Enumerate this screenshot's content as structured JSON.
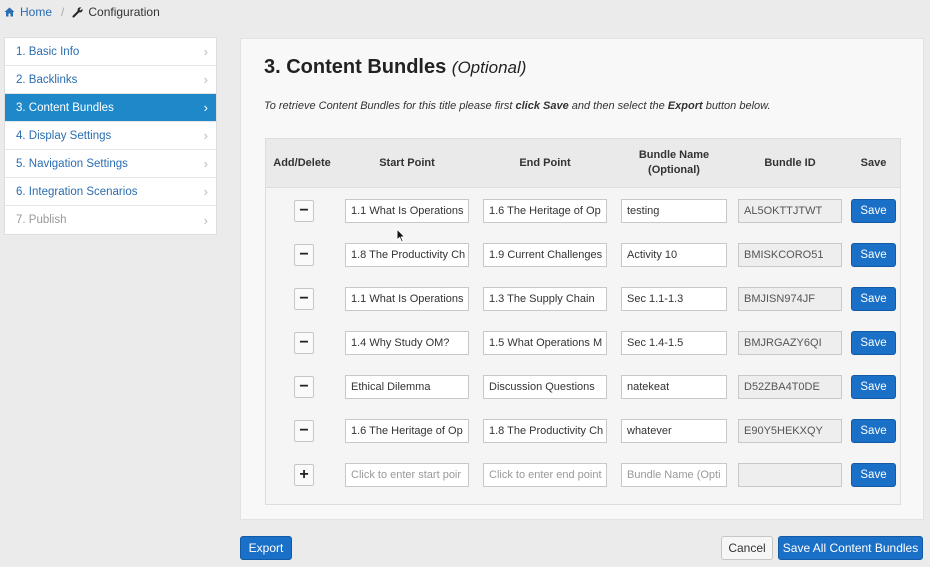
{
  "breadcrumb": {
    "home": "Home",
    "current": "Configuration"
  },
  "sidebar": {
    "items": [
      {
        "label": "1. Basic Info"
      },
      {
        "label": "2. Backlinks"
      },
      {
        "label": "3. Content Bundles"
      },
      {
        "label": "4. Display Settings"
      },
      {
        "label": "5. Navigation Settings"
      },
      {
        "label": "6. Integration Scenarios"
      },
      {
        "label": "7. Publish"
      }
    ]
  },
  "main": {
    "title": "3. Content Bundles",
    "title_optional": "(Optional)",
    "instruction": {
      "part1": "To retrieve Content Bundles for this title please first ",
      "bold1": "click Save",
      "part2": " and then select the ",
      "bold2": "Export",
      "part3": " button below."
    }
  },
  "table": {
    "headers": {
      "add_delete": "Add/Delete",
      "start": "Start Point",
      "end": "End Point",
      "name_line1": "Bundle Name",
      "name_line2": "(Optional)",
      "id": "Bundle ID",
      "save": "Save"
    },
    "rows": [
      {
        "action": "−",
        "start": "1.1 What Is Operations",
        "end": "1.6 The Heritage of Op",
        "name": "testing",
        "id": "AL5OKTTJTWT",
        "save": "Save"
      },
      {
        "action": "−",
        "start": "1.8 The Productivity Ch",
        "end": "1.9 Current Challenges",
        "name": "Activity 10",
        "id": "BMISKCORO51",
        "save": "Save"
      },
      {
        "action": "−",
        "start": "1.1 What Is Operations",
        "end": "1.3 The Supply Chain",
        "name": "Sec 1.1-1.3",
        "id": "BMJISN974JF",
        "save": "Save"
      },
      {
        "action": "−",
        "start": "1.4 Why Study OM?",
        "end": "1.5 What Operations M",
        "name": "Sec 1.4-1.5",
        "id": "BMJRGAZY6QI",
        "save": "Save"
      },
      {
        "action": "−",
        "start": "Ethical Dilemma",
        "end": "Discussion Questions",
        "name": "natekeat",
        "id": "D52ZBA4T0DE",
        "save": "Save"
      },
      {
        "action": "−",
        "start": "1.6 The Heritage of Op",
        "end": "1.8 The Productivity Ch",
        "name": "whatever",
        "id": "E90Y5HEKXQY",
        "save": "Save"
      }
    ],
    "new_row": {
      "action": "+",
      "start_placeholder": "Click to enter start poir",
      "end_placeholder": "Click to enter end point",
      "name_placeholder": "Bundle Name (Opti",
      "id": "",
      "save": "Save"
    }
  },
  "footer": {
    "export": "Export",
    "cancel": "Cancel",
    "save_all": "Save All Content Bundles"
  },
  "colors": {
    "accent": "#1a6fc7",
    "sidebar_active": "#1e88c9",
    "link": "#2a6db0"
  }
}
